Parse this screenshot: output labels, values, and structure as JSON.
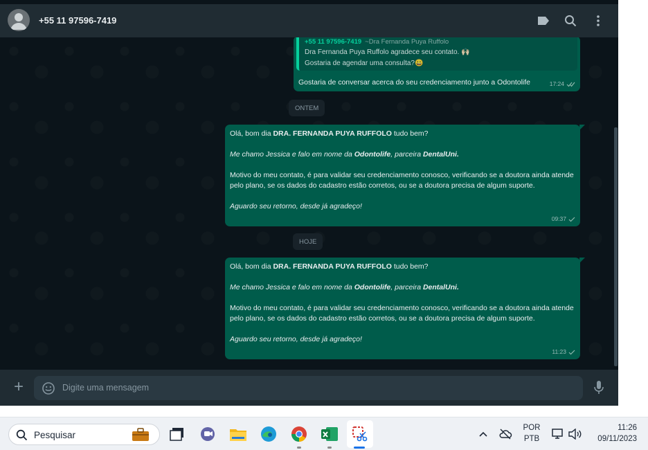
{
  "header": {
    "contact_name": "+55 11 97596-7419",
    "icons": [
      "label-icon",
      "search-icon",
      "kebab-menu-icon"
    ]
  },
  "messages": [
    {
      "quote": {
        "author": "+55 11 97596-7419",
        "author_alias": "~Dra Fernanda Puya Ruffolo",
        "line1": "Dra Fernanda Puya Ruffolo agradece seu contato. 🙌🏻",
        "line2": "Gostaria de agendar uma consulta?😀"
      },
      "text": "Gostaria de conversar acerca do seu credenciamento junto a Odontolife",
      "time": "17:24",
      "status": "read"
    }
  ],
  "day_chips": {
    "yesterday": "ONTEM",
    "today": "HOJE"
  },
  "message_template": {
    "greet_pre": "Olá, bom dia ",
    "greet_name": "DRA. FERNANDA PUYA RUFFOLO",
    "greet_post": " tudo bem?",
    "intro_pre": "Me chamo Jessica e falo em nome da ",
    "intro_brand": "Odontolife",
    "intro_mid": ", parceira ",
    "intro_partner": "DentalUni.",
    "body": "Motivo do meu contato, é para validar seu credenciamento conosco, verificando se a doutora ainda atende pelo plano, se os dados do cadastro estão corretos, ou se a doutora precisa de algum suporte.",
    "closing": "Aguardo seu retorno, desde já agradeço!"
  },
  "message_times": {
    "yesterday": "09:37",
    "today": "11:23"
  },
  "composer": {
    "placeholder": "Digite uma mensagem"
  },
  "taskbar": {
    "search_label": "Pesquisar",
    "language": "POR",
    "layout": "PTB",
    "time": "11:26",
    "date": "09/11/2023",
    "apps": [
      "file-manager-icon",
      "teams-icon",
      "folder-icon",
      "edge-icon",
      "chrome-icon",
      "excel-icon",
      "snipping-tool-icon"
    ]
  },
  "colors": {
    "chat_bg": "#0b141a",
    "header_bg": "#202c33",
    "outgoing_bubble": "#005c4b",
    "accent": "#06cf9c"
  }
}
